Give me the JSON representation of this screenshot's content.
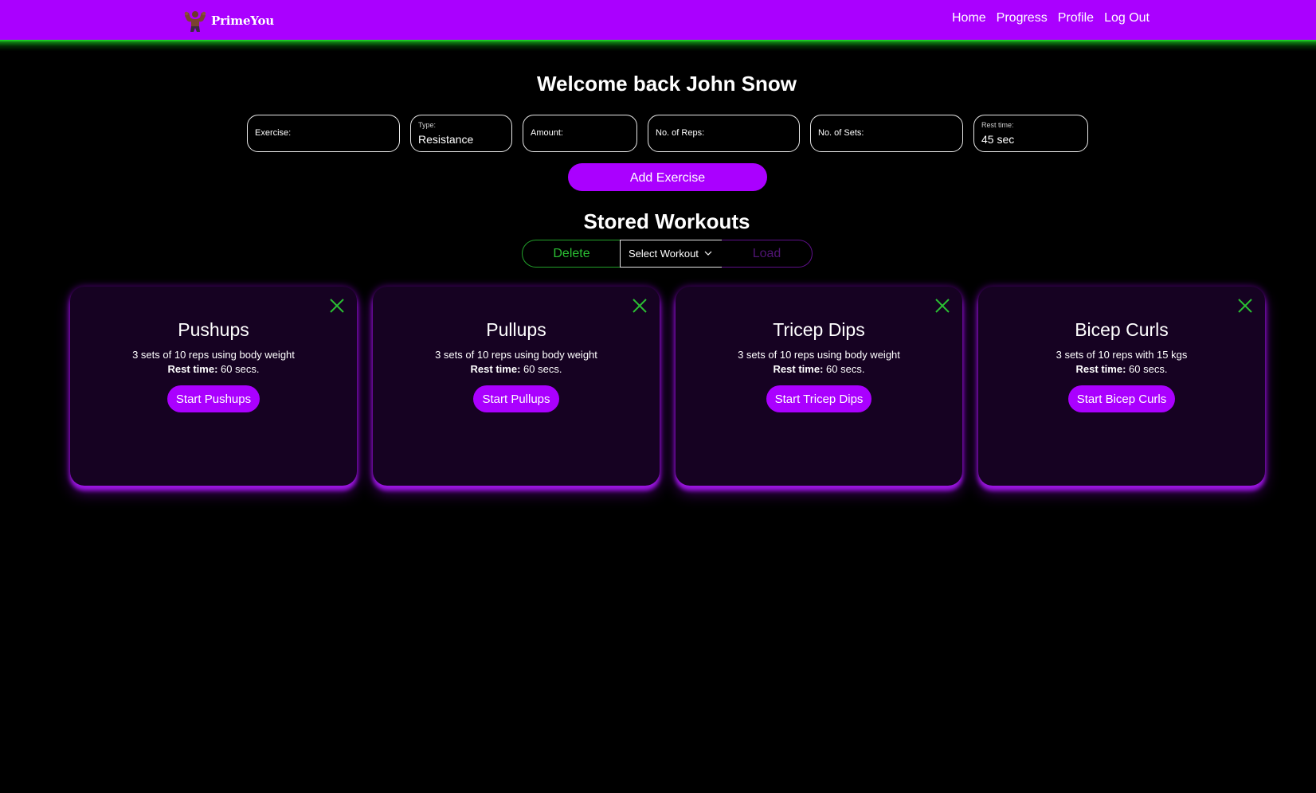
{
  "navbar": {
    "brand_name": "PrimeYou",
    "logo_icon": "bodybuilder-logo-icon",
    "links": [
      "Home",
      "Progress",
      "Profile",
      "Log Out"
    ]
  },
  "welcome": "Welcome back John Snow",
  "form": {
    "exercise_label": "Exercise:",
    "type_label": "Type:",
    "type_value": "Resistance",
    "amount_label": "Amount:",
    "reps_label": "No. of Reps:",
    "sets_label": "No. of Sets:",
    "rest_label": "Rest time:",
    "rest_value": "45 sec",
    "add_button": "Add Exercise"
  },
  "stored": {
    "title": "Stored Workouts",
    "delete_label": "Delete",
    "select_label": "Select Workout",
    "load_label": "Load"
  },
  "cards": [
    {
      "title": "Pushups",
      "desc": "3 sets of 10 reps using body weight",
      "rest_label": "Rest time:",
      "rest_value": " 60 secs.",
      "button": "Start Pushups"
    },
    {
      "title": "Pullups",
      "desc": "3 sets of 10 reps using body weight",
      "rest_label": "Rest time:",
      "rest_value": " 60 secs.",
      "button": "Start Pullups"
    },
    {
      "title": "Tricep Dips",
      "desc": "3 sets of 10 reps using body weight",
      "rest_label": "Rest time:",
      "rest_value": " 60 secs.",
      "button": "Start Tricep Dips"
    },
    {
      "title": "Bicep Curls",
      "desc": "3 sets of 10 reps with 15 kgs",
      "rest_label": "Rest time:",
      "rest_value": " 60 secs.",
      "button": "Start Bicep Curls"
    }
  ],
  "colors": {
    "brand": "#aa00ff",
    "accent_green": "#2bbf33",
    "card_bg": "#160222"
  }
}
